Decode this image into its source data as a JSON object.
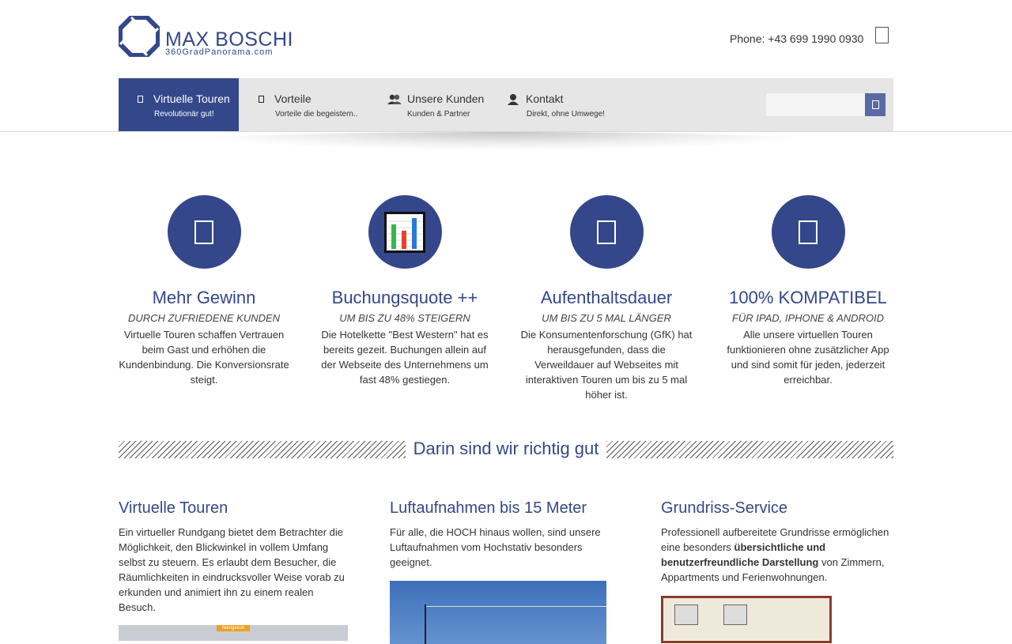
{
  "brand": {
    "name": "MAX BOSCHI",
    "sub": "360GradPanorama.com",
    "color": "#34478a"
  },
  "header": {
    "phone": "Phone: +43 699 1990 0930",
    "phone_icon": "mobile-phone-icon"
  },
  "nav": {
    "items": [
      {
        "label": "Virtuelle Touren",
        "sub": "Revolutionär gut!",
        "icon": "camera-icon",
        "active": true
      },
      {
        "label": "Vorteile",
        "sub": "Vorteile die begeistern..",
        "icon": "star-icon",
        "active": false
      },
      {
        "label": "Unsere Kunden",
        "sub": "Kunden & Partner",
        "icon": "users-icon",
        "active": false
      },
      {
        "label": "Kontakt",
        "sub": "Direkt, ohne Umwege!",
        "icon": "user-icon",
        "active": false
      }
    ],
    "search_placeholder": "",
    "search_icon": "search-icon"
  },
  "features": [
    {
      "title": "Mehr Gewinn",
      "subtitle": "DURCH ZUFRIEDENE KUNDEN",
      "text": "Virtuelle Touren schaffen Vertrauen beim Gast und erhöhen die Kundenbindung. Die Konversionsrate steigt.",
      "icon": "money-icon"
    },
    {
      "title": "Buchungsquote ++",
      "subtitle": "UM BIS ZU 48% STEIGERN",
      "text": "Die Hotelkette \"Best Western\" hat es bereits gezeit. Buchungen allein auf der Webseite des Unternehmens um fast 48% gestiegen.",
      "icon": "bar-chart-icon"
    },
    {
      "title": "Aufenthaltsdauer",
      "subtitle": "UM BIS ZU 5 MAL LÄNGER",
      "text": "Die Konsumentenforschung (GfK) hat herausgefunden, dass die Verweildauer auf Webseites mit interaktiven Touren um bis zu 5 mal höher ist.",
      "icon": "clock-icon"
    },
    {
      "title": "100% KOMPATIBEL",
      "subtitle": "FÜR IPAD, IPHONE & ANDROID",
      "text": "Alle unsere virtuellen Touren funktionieren ohne zusätzlicher App und sind somit für jeden, jederzeit erreichbar.",
      "icon": "devices-icon"
    }
  ],
  "section_title": "Darin sind wir richtig gut",
  "services": [
    {
      "title": "Virtuelle Touren",
      "text": "Ein virtueller Rundgang bietet dem Betrachter die Möglichkeit, den Blickwinkel in vollem Umfang selbst zu steuern. Es erlaubt dem Besucher, die Räumlichkeiten in eindrucksvoller Weise vorab zu erkunden und animiert ihn zu einem realen Besuch."
    },
    {
      "title": "Luftaufnahmen bis 15 Meter",
      "text": "Für alle, die HOCH hinaus wollen, sind unsere Luftaufnahmen vom Hochstativ besonders geeignet."
    },
    {
      "title": "Grundriss-Service",
      "text_a": "Professionell aufbereitete Grundrisse ermöglichen eine besonders ",
      "text_bold": "übersichtliche und benutzerfreundliche Darstellung",
      "text_b": " von Zimmern, Appartments und Ferienwohnungen."
    }
  ],
  "images": {
    "tour_nav_tag": "Navigation"
  }
}
